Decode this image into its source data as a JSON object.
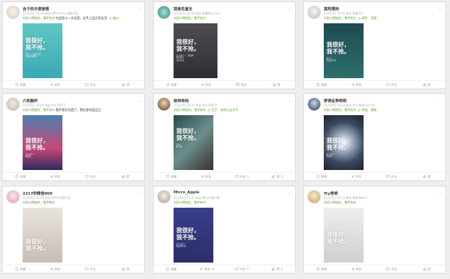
{
  "colors": {
    "topic_green": "#5a9a2e",
    "meta_gray": "#aaaaaa",
    "comment_orange": "#f26b21"
  },
  "action_labels": {
    "favorite": "收藏",
    "repost": "转发",
    "comment": "评论",
    "like": "赞"
  },
  "posts": [
    {
      "username": "吉子的天使旅情",
      "meta": "11月15日 16:19 来自 OPPO Reno 智能手机",
      "text_tag": "#双十特别好，我不抢#",
      "text_body": " 比起双十一买东西，比不上自己的生活",
      "location": "◎ 福州",
      "headline": "我很好，\n我不抢。",
      "sub": "双十一，我买不起\n但我依然很好",
      "counts": {
        "repost": "",
        "comment": "",
        "like": ""
      }
    },
    {
      "username": "我是花鼠无",
      "meta": "11月15日 20:43 来自 荣耀Play vivo",
      "text_tag": "#双十特别好，我不抢#",
      "text_body": "",
      "location": "",
      "headline": "我很好，\n我不抢。",
      "sub": "这个双十一，我选择\n照顾自己\n好好生活",
      "counts": {
        "repost": "",
        "comment": "",
        "like": ""
      }
    },
    {
      "username": "莫阿理帅",
      "meta": "11月15日 15:18 来自 荣耀 X2",
      "text_tag": "#双十特别好，我不抢#",
      "text_body": "",
      "location": "◎ 城市 · 济南",
      "headline": "我很好，\n我不抢。",
      "sub": "双十一\n我选择不抢",
      "counts": {
        "repost": "",
        "comment": "",
        "like": ""
      }
    },
    {
      "username": "六和魅杯",
      "meta": "11月15日 20:24 来自 华为 PRO T",
      "text_tag": "#双十特别好，我不抢#",
      "text_body": " 我不想买东西了，我在意的是自己",
      "location": "",
      "headline": "我很好，\n我不抢。",
      "sub": "这个双十一\n我很好",
      "counts": {
        "repost": "",
        "comment": "",
        "like": ""
      }
    },
    {
      "username": "故林地地",
      "meta": "11月15日 16:37 来自 华为 PRO 9",
      "text_tag": "#双十特别好，我不抢#",
      "text_body": "",
      "location": "◎ 辽宁 · 沈阳工业大学",
      "headline": "我很好，\n我不抢。",
      "sub": "双十一\n我不抢",
      "counts": {
        "repost": "",
        "comment": "1",
        "like": "4"
      }
    },
    {
      "username": "梦得征寿明明",
      "meta": "11月15日 16:24 来自 华为 Mate 10 Pro",
      "text_tag": "#双十特别好，我不抢#",
      "text_body": "",
      "location": "◎ 中国 · 湖南",
      "headline": "我很好，\n我不抢。",
      "sub": "这个双十一\n我很好",
      "counts": {
        "repost": "",
        "comment": "",
        "like": ""
      }
    },
    {
      "username": "2217的微信900",
      "meta": "11月15日 23:46 来自 OPPO 智能手机",
      "text_tag": "#双十特别好，我不抢#",
      "text_body": "",
      "location": "",
      "headline": "我很好，\n我不抢。",
      "sub": "",
      "counts": {
        "repost": "",
        "comment": "",
        "like": ""
      }
    },
    {
      "username": "Micro_Apple",
      "meta": "11月15日 13:35 来自 iPhone客户端",
      "text_tag": "#双十特别好，我不抢#",
      "text_body": "",
      "location": "",
      "headline": "我很好，\n我不抢。",
      "sub": "这个双十一\n我选择不抢",
      "counts": {
        "repost": "4",
        "comment": "1",
        "like": "1"
      }
    },
    {
      "username": "Try爸爸",
      "meta": "11月15日 22:13 来自 荣耀 Note3",
      "text_tag": "#双十特别好，我不抢#",
      "text_body": "",
      "location": "",
      "headline": "我很好，\n我不抢。",
      "sub": "",
      "counts": {
        "repost": "",
        "comment": "",
        "like": ""
      }
    }
  ]
}
